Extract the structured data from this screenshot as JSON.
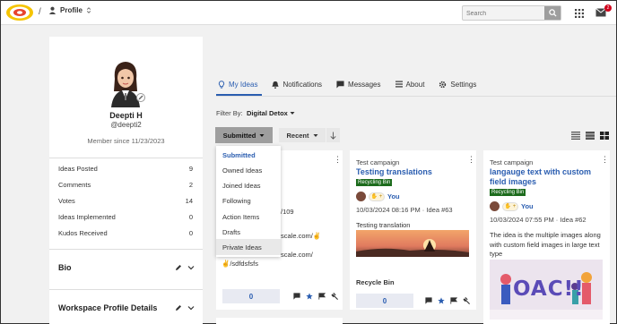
{
  "nav": {
    "breadcrumb_sep": "/",
    "profile_label": "Profile",
    "search_placeholder": "Search",
    "notification_count": "2"
  },
  "profile": {
    "name": "Deepti H",
    "handle": "@deepti2",
    "member_since": "Member since 11/23/2023",
    "stats": [
      {
        "label": "Ideas Posted",
        "value": "9"
      },
      {
        "label": "Comments",
        "value": "2"
      },
      {
        "label": "Votes",
        "value": "14"
      },
      {
        "label": "Ideas Implemented",
        "value": "0"
      },
      {
        "label": "Kudos Received",
        "value": "0"
      }
    ],
    "sections": [
      {
        "title": "Bio"
      },
      {
        "title": "Workspace Profile Details"
      }
    ]
  },
  "tabs": [
    {
      "label": "My Ideas",
      "icon": "bulb-icon"
    },
    {
      "label": "Notifications",
      "icon": "bell-icon"
    },
    {
      "label": "Messages",
      "icon": "chat-icon"
    },
    {
      "label": "About",
      "icon": "list-icon"
    },
    {
      "label": "Settings",
      "icon": "gear-icon"
    }
  ],
  "filter": {
    "label": "Filter By:",
    "value": "Digital Detox"
  },
  "controls": {
    "status_label": "Submitted",
    "sort_label": "Recent"
  },
  "dropdown": {
    "items": [
      "Submitted",
      "Owned Ideas",
      "Joined Ideas",
      "Following",
      "Action Items",
      "Drafts",
      "Private Ideas"
    ],
    "selected": "Submitted",
    "hovered": "Private Ideas"
  },
  "cards": [
    {
      "campaign": "",
      "fragments": [
        "/109",
        "scale.com/✌",
        "scale.com/",
        "✌/sdfdsfsfs"
      ],
      "votes": "0"
    },
    {
      "campaign": "Test campaign",
      "title": "Testing translations",
      "badge": "Recycling Bin",
      "author": "You",
      "meta": "10/03/2024 08:16 PM · Idea #63",
      "body": "Testing translation",
      "status": "Recycle Bin",
      "votes": "0"
    },
    {
      "campaign": "Test campaign",
      "title": "langauge text with custom field images",
      "badge": "Recycling Bin",
      "author": "You",
      "meta": "10/03/2024 07:55 PM · Idea #62",
      "body": "The idea is the multiple images along with custom field images in large text type",
      "image_text": "OAC!!"
    }
  ],
  "colors": {
    "accent": "#2a5db0",
    "badge": "#1c6b1c",
    "alert": "#d0021b"
  }
}
